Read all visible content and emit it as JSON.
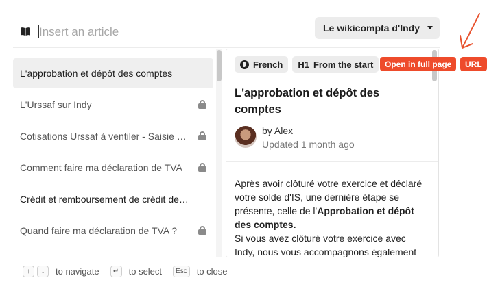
{
  "search": {
    "placeholder": "Insert an article",
    "value": ""
  },
  "knowledge_base": {
    "selected": "Le wikicompta d'Indy"
  },
  "articles": [
    {
      "title": "L'approbation et dépôt des comptes",
      "locked": false,
      "selected": true
    },
    {
      "title": "L'Urssaf sur Indy",
      "locked": true,
      "selected": false
    },
    {
      "title": "Cotisations Urssaf à ventiler - Saisie des cotisations",
      "locked": true,
      "selected": false
    },
    {
      "title": "Comment faire ma déclaration de TVA",
      "locked": true,
      "selected": false
    },
    {
      "title": "Crédit et remboursement de crédit de TVA",
      "locked": false,
      "selected": false
    },
    {
      "title": "Quand faire ma déclaration de TVA ?",
      "locked": true,
      "selected": false
    }
  ],
  "preview": {
    "language_tag": "French",
    "heading_tag_prefix": "H1",
    "heading_tag": "From the start",
    "title": "L'approbation et dépôt des comptes",
    "author": "by Alex",
    "updated": "Updated 1 month ago",
    "body_part1": "Après avoir clôturé votre exercice et déclaré votre solde d'IS, une dernière étape se présente, celle de l'",
    "body_bold": "Approbation et dépôt des comptes.",
    "body_part2": "Si vous avez clôturé votre exercice avec Indy, nous vous accompagnons également pour cette nouvelle étape."
  },
  "actions": {
    "open_full_page": "Open in full page",
    "url": "URL"
  },
  "footer": {
    "navigate_keys": [
      "↑",
      "↓"
    ],
    "navigate_label": "to navigate",
    "select_key": "↵",
    "select_label": "to select",
    "close_key": "Esc",
    "close_label": "to close"
  },
  "colors": {
    "accent": "#ee4b2b",
    "arrow": "#e8522e"
  }
}
